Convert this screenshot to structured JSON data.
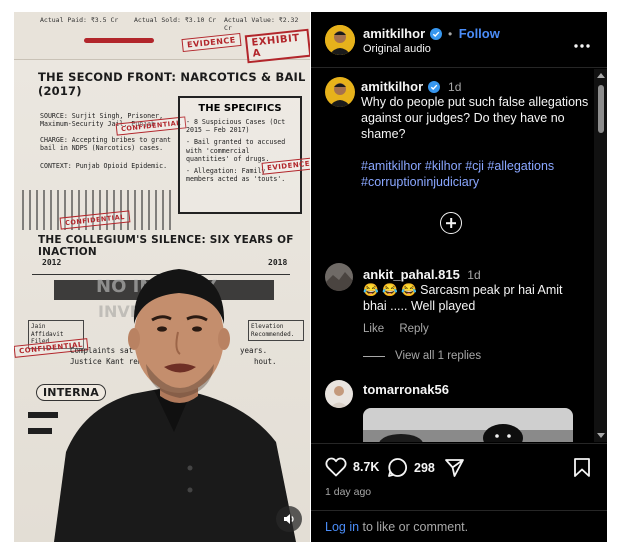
{
  "media": {
    "ledger": [
      "Actual Paid: ₹3.5 Cr",
      "Actual Sold: ₹3.10 Cr",
      "Actual Value: ₹2.32 Cr"
    ],
    "stamps": {
      "evidence": "EVIDENCE",
      "exhibit": "EXHIBIT A",
      "confidential": "CONFIDENTIAL",
      "evidence2": "EVIDENCE",
      "confidential2": "CONFIDENTIAL",
      "confidential3": "CONFIDENTIAL"
    },
    "heading1": "THE SECOND FRONT: NARCOTICS & BAIL (2017)",
    "source": "SOURCE: Surjit Singh, Prisoner, Maximum-Security Jail, Punjab",
    "charge": "CHARGE: Accepting bribes to grant bail in NDPS (Narcotics) cases.",
    "context": "CONTEXT: Punjab Opioid Epidemic.",
    "specs_title": "THE SPECIFICS",
    "specs": [
      "- 8 Suspicious Cases (Oct 2015 – Feb 2017)",
      "- Bail granted to accused with 'commercial quantities' of drugs.",
      "- Allegation: Family members acted as 'touts'."
    ],
    "heading2": "THE COLLEGIUM'S SILENCE: SIX YEARS OF INACTION",
    "year_start": "2012",
    "year_end": "2018",
    "stamp_inaction": "NO INQUIRY",
    "inv": "INVE",
    "affidavit": "Jain Affidavit Filed.",
    "elevation": "Elevation Recommended.",
    "complaints": "Complaints sat wi",
    "years": "years.",
    "justice": "Justice Kant remai",
    "without": "hout.",
    "intern": "INTERNA"
  },
  "post": {
    "username": "amitkilhor",
    "follow_label": "Follow",
    "dot": "•",
    "audio": "Original audio",
    "more_icon": "more-horizontal-icon"
  },
  "caption": {
    "username": "amitkilhor",
    "time": "1d",
    "text": "Why do people put such false allegations against our judges? Do they have no shame?",
    "hashtags": "#amitkilhor #kilhor #cji #allegations #corruptioninjudiciary"
  },
  "comments": [
    {
      "username": "ankit_pahal.815",
      "time": "1d",
      "text": "😂 😂 😂 Sarcasm peak pr hai Amit bhai ..... Well played",
      "like": "Like",
      "reply": "Reply",
      "view_replies": "View all 1 replies"
    },
    {
      "username": "tomarronak56"
    }
  ],
  "actions": {
    "likes": "8.7K",
    "comments": "298",
    "time": "1 day ago",
    "login_link": "Log in",
    "login_rest": " to like or comment."
  },
  "colors": {
    "accent_blue": "#4a8cf7",
    "hashtag": "#8aa7ff",
    "panel_bg": "#000000",
    "stamp_red": "#b2262b"
  }
}
